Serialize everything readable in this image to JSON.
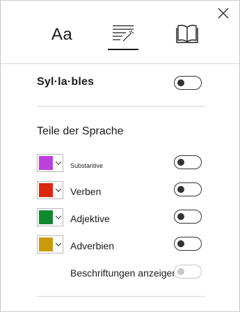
{
  "tabs": {
    "text_options_label": "Aa",
    "grammar_icon": "grammar-options-icon",
    "reading_icon": "reading-preferences-icon"
  },
  "syllables": {
    "label": "Syl·la·bles",
    "state": "off"
  },
  "parts_of_speech": {
    "title": "Teile der Sprache",
    "items": [
      {
        "label": "Substantive",
        "color": "#c03fdc",
        "state": "off"
      },
      {
        "label": "Verben",
        "color": "#d8290e",
        "state": "off"
      },
      {
        "label": "Adjektive",
        "color": "#0e8a2f",
        "state": "off"
      },
      {
        "label": "Adverbien",
        "color": "#c99a0c",
        "state": "off"
      }
    ],
    "show_labels": {
      "label": "Beschriftungen anzeigen",
      "state": "off",
      "enabled": false
    }
  },
  "colors": {
    "text": "#1b1b1b",
    "divider": "#d6d6d6",
    "toggle_off": "#333333",
    "toggle_disabled": "#c6c6c6"
  }
}
